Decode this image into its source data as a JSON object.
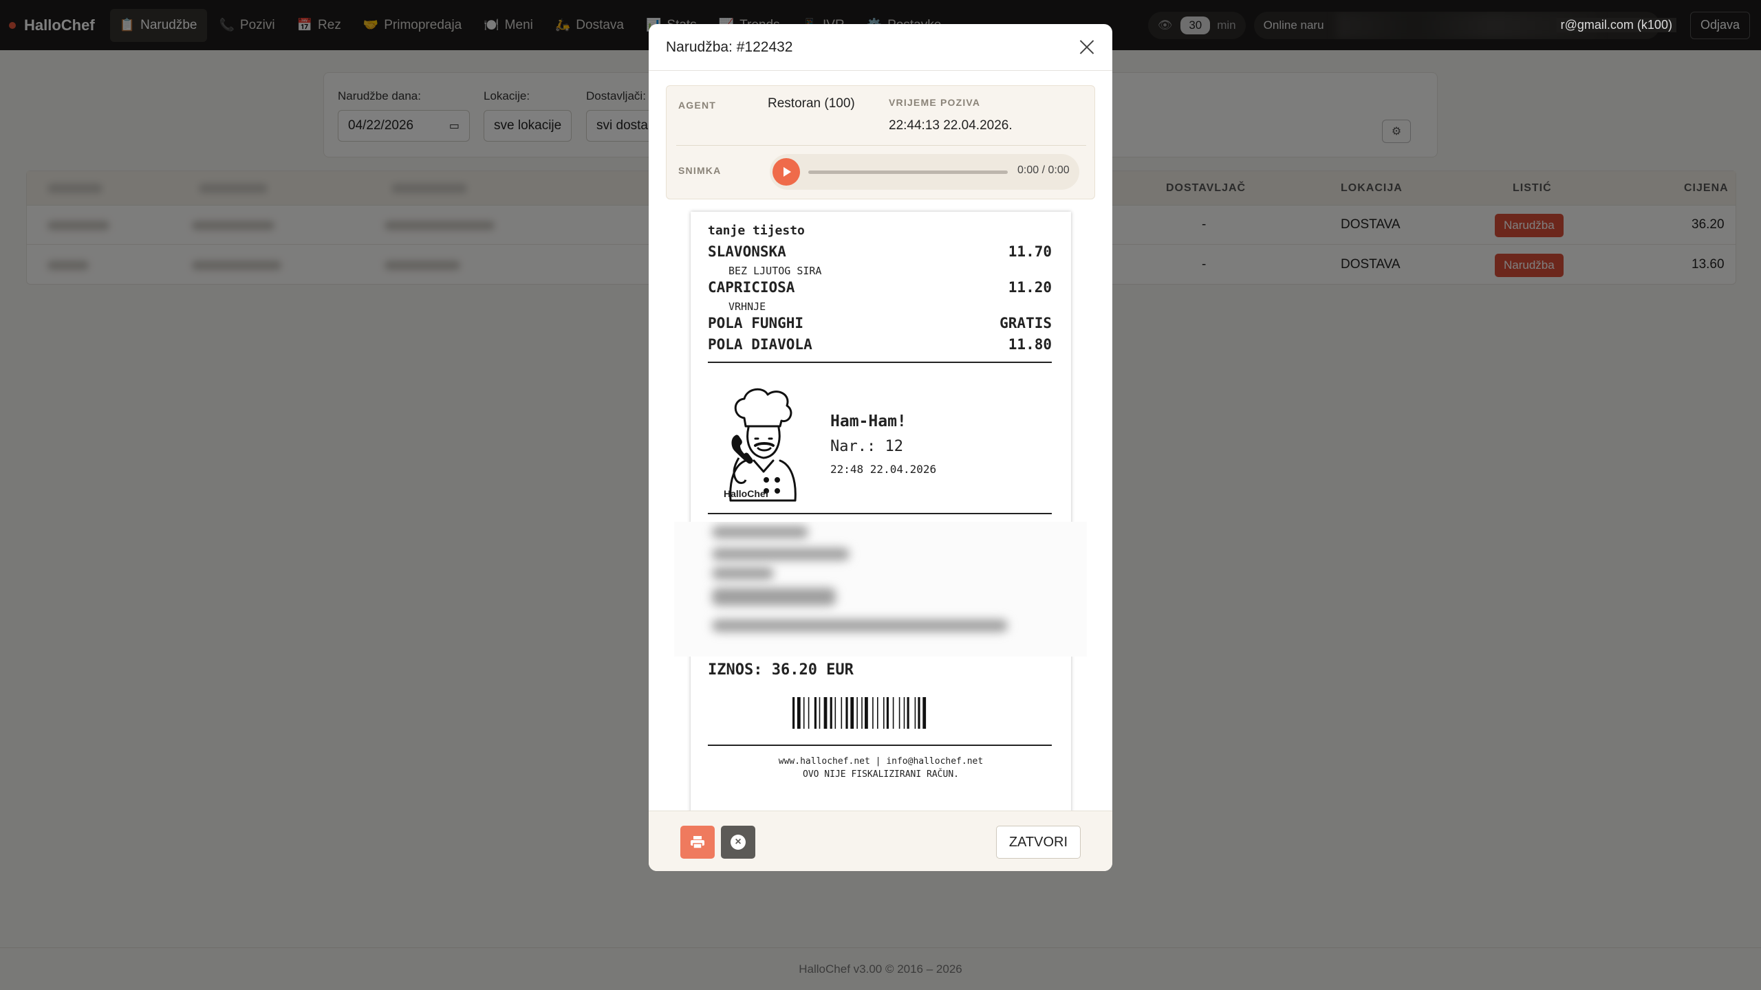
{
  "nav": {
    "brand": "HalloChef",
    "items": [
      {
        "icon": "📋",
        "label": "Narudžbe",
        "active": true
      },
      {
        "icon": "📞",
        "label": "Pozivi"
      },
      {
        "icon": "📅",
        "label": "Rez"
      },
      {
        "icon": "🤝",
        "label": "Primopredaja"
      },
      {
        "icon": "🍽️",
        "label": "Meni"
      },
      {
        "icon": "🛵",
        "label": "Dostava"
      },
      {
        "icon": "📊",
        "label": "Stats"
      },
      {
        "icon": "📈",
        "label": "Trends"
      },
      {
        "icon": "📱",
        "label": "IVR"
      },
      {
        "icon": "⚙️",
        "label": "Postavke"
      }
    ],
    "refresh_value": "30",
    "refresh_unit": "min",
    "online_label": "Online naru",
    "user": "r@gmail.com (k100)",
    "logout": "Odjava"
  },
  "filters": {
    "date_label": "Narudžbe dana:",
    "date_value": "04/22/2026",
    "location_label": "Lokacije:",
    "location_value": "sve lokacije",
    "courier_label": "Dostavljači:",
    "courier_value": "svi dosta"
  },
  "table": {
    "headers": {
      "courier": "DOSTAVLJAČ",
      "location": "LOKACIJA",
      "slip": "LISTIĆ",
      "price": "CIJENA"
    },
    "rows": [
      {
        "courier": "-",
        "location": "DOSTAVA",
        "slip": "Narudžba",
        "price": "36.20"
      },
      {
        "courier": "-",
        "location": "DOSTAVA",
        "slip": "Narudžba",
        "price": "13.60"
      }
    ]
  },
  "footer": "HalloChef v3.00 © 2016 – 2026",
  "modal": {
    "title": "Narudžba: #122432",
    "agent_label": "AGENT",
    "agent_value": "Restoran (100)",
    "call_time_label": "VRIJEME POZIVA",
    "call_time_value": "22:44:13 22.04.2026.",
    "recording_label": "SNIMKA",
    "recording_time": "0:00 / 0:00",
    "close_label": "ZATVORI"
  },
  "receipt": {
    "note": "tanje tijesto",
    "items": [
      {
        "name": "SLAVONSKA",
        "price": "11.70",
        "sub": "BEZ LJUTOG SIRA"
      },
      {
        "name": "CAPRICIOSA",
        "price": "11.20",
        "sub": "VRHNJE"
      },
      {
        "name": "POLA FUNGHI",
        "price": "GRATIS"
      },
      {
        "name": "POLA DIAVOLA",
        "price": "11.80"
      }
    ],
    "logo_caption": "HalloChef",
    "brand": "Ham-Ham!",
    "order_no": "Nar.: 12",
    "datetime": "22:48 22.04.2026",
    "total": "IZNOS: 36.20 EUR",
    "web": "www.hallochef.net | info@hallochef.net",
    "disclaimer": "OVO NIJE FISKALIZIRANI RAČUN."
  }
}
